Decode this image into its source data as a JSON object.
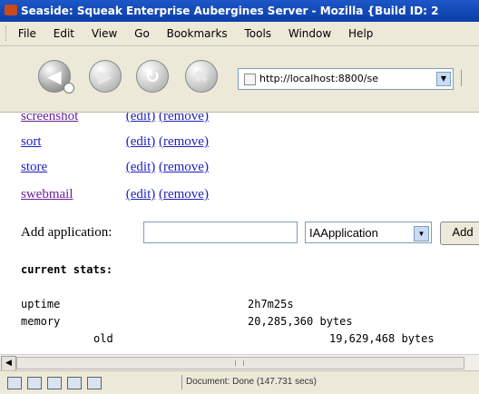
{
  "window": {
    "title": "Seaside: Squeak Enterprise Aubergines Server - Mozilla {Build ID: 2"
  },
  "menu": [
    "File",
    "Edit",
    "View",
    "Go",
    "Bookmarks",
    "Tools",
    "Window",
    "Help"
  ],
  "url": "http://localhost:8800/se",
  "apps": [
    {
      "name": "screenshot",
      "edit": "(edit)",
      "remove": "(remove)"
    },
    {
      "name": "sort",
      "edit": "(edit)",
      "remove": "(remove)"
    },
    {
      "name": "store",
      "edit": "(edit)",
      "remove": "(remove)"
    },
    {
      "name": "swebmail",
      "edit": "(edit)",
      "remove": "(remove)"
    }
  ],
  "add_app": {
    "label": "Add application:",
    "input_value": "",
    "select_value": "IAApplication",
    "button": "Add"
  },
  "stats": {
    "heading": "current stats:",
    "rows": [
      {
        "key": "uptime",
        "value": "2h7m25s"
      },
      {
        "key": "memory",
        "value": "20,285,360 bytes"
      },
      {
        "key": "old",
        "value": "19,629,468 bytes"
      }
    ]
  },
  "status": {
    "text": "Document: Done (147.731 secs)"
  },
  "colors": {
    "link": "#1f1fbf",
    "visited": "#6a1f99",
    "titlebar": "#1c57c8"
  }
}
